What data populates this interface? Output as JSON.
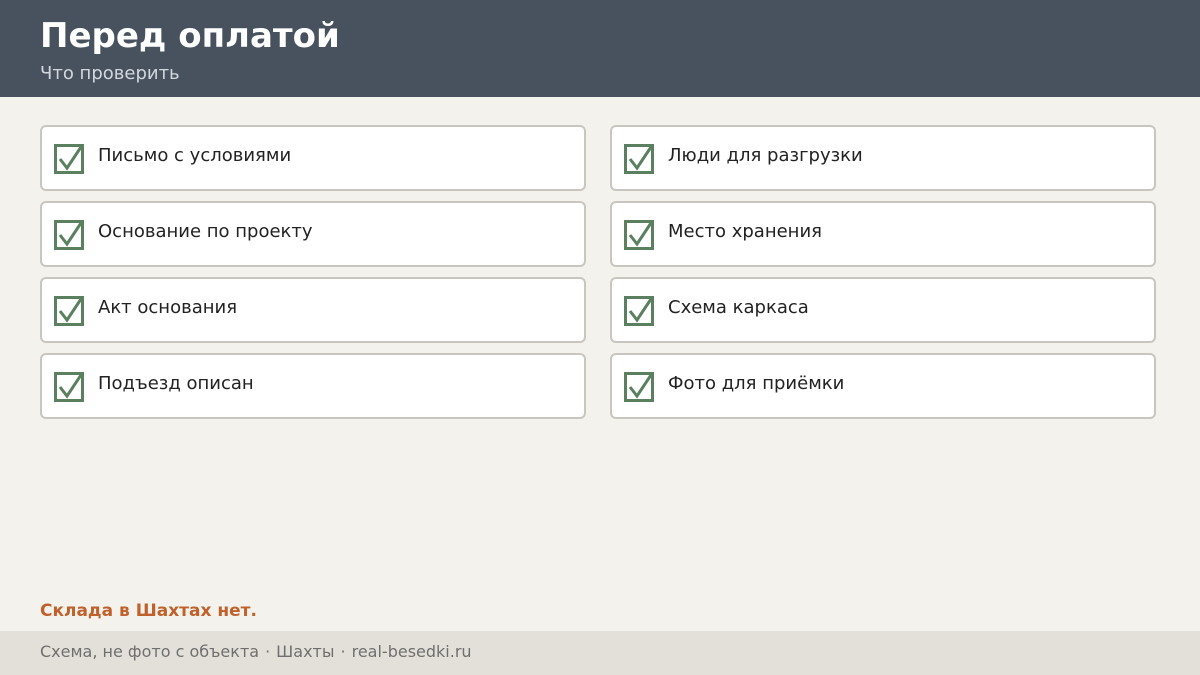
{
  "header": {
    "title": "Перед оплатой",
    "subtitle": "Что проверить"
  },
  "checklist": {
    "left": [
      {
        "label": "Письмо с условиями",
        "checked": true
      },
      {
        "label": "Основание по проекту",
        "checked": true
      },
      {
        "label": "Акт основания",
        "checked": true
      },
      {
        "label": "Подъезд описан",
        "checked": true
      }
    ],
    "right": [
      {
        "label": "Люди для разгрузки",
        "checked": true
      },
      {
        "label": "Место хранения",
        "checked": true
      },
      {
        "label": "Схема каркаса",
        "checked": true
      },
      {
        "label": "Фото для приёмки",
        "checked": true
      }
    ]
  },
  "note": "Склада в Шахтах нет.",
  "footer": {
    "caption": "Схема, не фото с объекта",
    "separator": "·",
    "city": "Шахты",
    "site": "real-besedki.ru"
  },
  "colors": {
    "header_bg": "#48525f",
    "page_bg": "#f4f2ed",
    "check": "#5b8060",
    "note": "#c0602a",
    "footer_bg": "#e3e0d9"
  },
  "icons": {
    "checkbox": "checkmark-icon"
  }
}
